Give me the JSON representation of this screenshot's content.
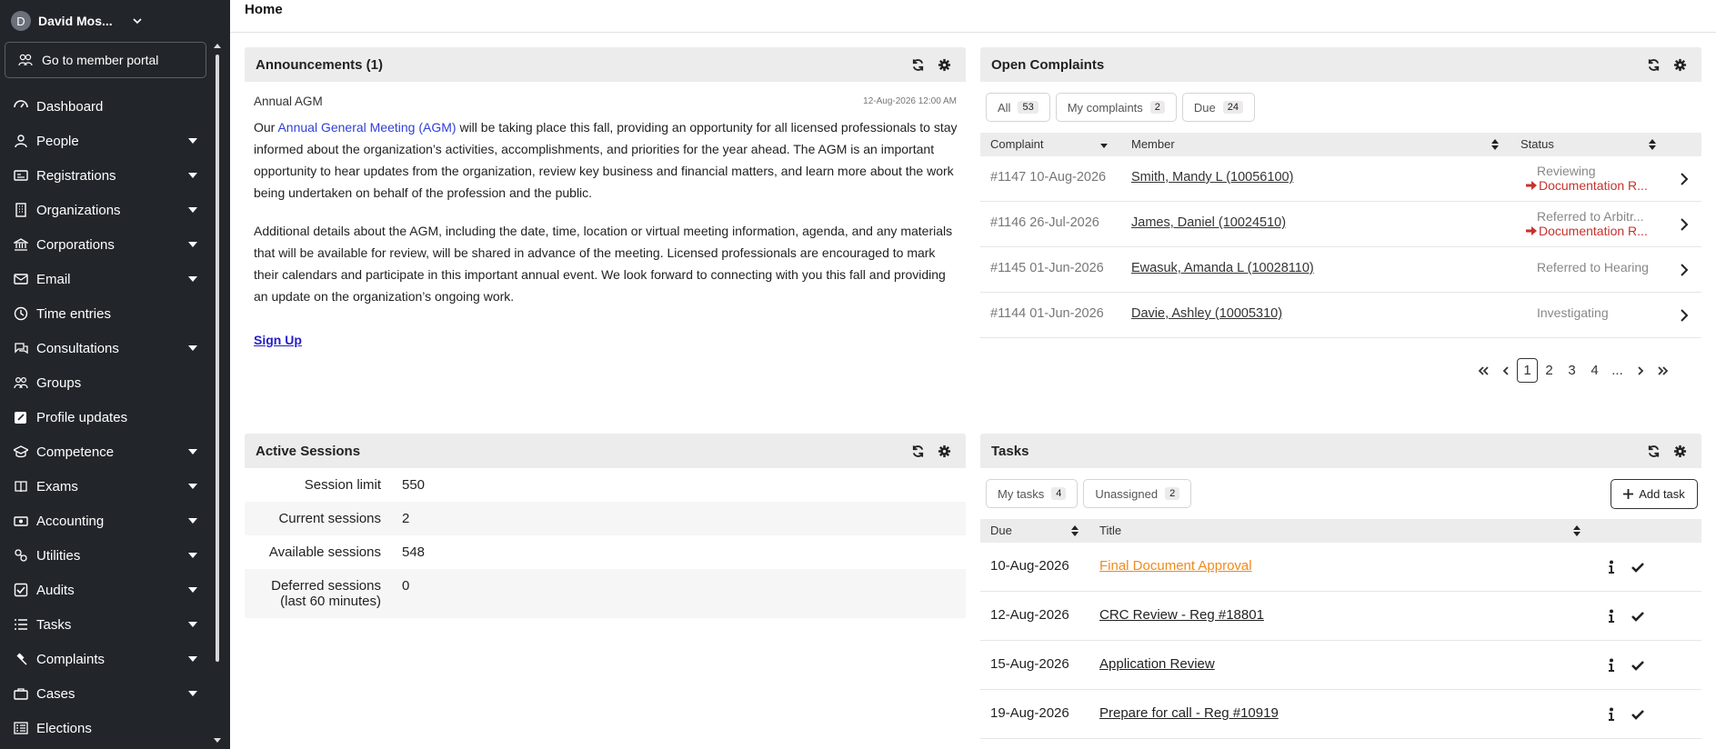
{
  "sidebar": {
    "user": {
      "initial": "D",
      "name": "David Mos..."
    },
    "portal_label": "Go to member portal",
    "items": [
      {
        "label": "Dashboard",
        "icon": "dashboard-icon",
        "expandable": false
      },
      {
        "label": "People",
        "icon": "person-icon",
        "expandable": true
      },
      {
        "label": "Registrations",
        "icon": "id-card-icon",
        "expandable": true
      },
      {
        "label": "Organizations",
        "icon": "building-icon",
        "expandable": true
      },
      {
        "label": "Corporations",
        "icon": "bank-icon",
        "expandable": true
      },
      {
        "label": "Email",
        "icon": "envelope-icon",
        "expandable": true
      },
      {
        "label": "Time entries",
        "icon": "clock-icon",
        "expandable": false
      },
      {
        "label": "Consultations",
        "icon": "chat-icon",
        "expandable": true
      },
      {
        "label": "Groups",
        "icon": "group-icon",
        "expandable": false
      },
      {
        "label": "Profile updates",
        "icon": "edit-icon",
        "expandable": false
      },
      {
        "label": "Competence",
        "icon": "graduation-cap-icon",
        "expandable": true
      },
      {
        "label": "Exams",
        "icon": "book-icon",
        "expandable": true
      },
      {
        "label": "Accounting",
        "icon": "money-icon",
        "expandable": true
      },
      {
        "label": "Utilities",
        "icon": "tools-icon",
        "expandable": true
      },
      {
        "label": "Audits",
        "icon": "check-square-icon",
        "expandable": true
      },
      {
        "label": "Tasks",
        "icon": "list-icon",
        "expandable": true
      },
      {
        "label": "Complaints",
        "icon": "gavel-icon",
        "expandable": true
      },
      {
        "label": "Cases",
        "icon": "briefcase-icon",
        "expandable": true
      },
      {
        "label": "Elections",
        "icon": "ballot-icon",
        "expandable": false
      }
    ]
  },
  "page_title": "Home",
  "announcements": {
    "title": "Announcements (1)",
    "item_title": "Annual AGM",
    "date": "12-Aug-2026 12:00 AM",
    "p1_prefix": "Our ",
    "p1_link": "Annual General Meeting (AGM)",
    "p1_rest": " will be taking place this fall, providing an opportunity for all licensed professionals to stay informed about the organization’s activities, accomplishments, and priorities for the year ahead. The AGM is an important opportunity to hear updates from the organization, review key business and financial matters, and learn more about the work being undertaken on behalf of the profession and the public.",
    "p2": "Additional details about the AGM, including the date, time, location or virtual meeting information, agenda, and any materials that will be available for review, will be shared in advance of the meeting. Licensed professionals are encouraged to mark their calendars and participate in this important annual event. We look forward to connecting with you this fall and providing an update on the organization’s ongoing work.",
    "signup": "Sign Up"
  },
  "complaints": {
    "title": "Open Complaints",
    "filters": [
      {
        "label": "All",
        "count": "53"
      },
      {
        "label": "My complaints",
        "count": "2"
      },
      {
        "label": "Due",
        "count": "24"
      }
    ],
    "columns": {
      "complaint": "Complaint",
      "member": "Member",
      "status": "Status"
    },
    "rows": [
      {
        "id": "#1147 10-Aug-2026",
        "member": "Smith, Mandy L (10056100)",
        "status": "Reviewing",
        "status2": "Documentation R..."
      },
      {
        "id": "#1146 26-Jul-2026",
        "member": "James, Daniel (10024510)",
        "status": "Referred to Arbitr...",
        "status2": "Documentation R..."
      },
      {
        "id": "#1145 01-Jun-2026",
        "member": "Ewasuk, Amanda L (10028110)",
        "status": "Referred to Hearing",
        "status2": ""
      },
      {
        "id": "#1144 01-Jun-2026",
        "member": "Davie, Ashley (10005310)",
        "status": "Investigating",
        "status2": ""
      }
    ],
    "pager": {
      "pages": [
        "1",
        "2",
        "3",
        "4",
        "..."
      ],
      "current": "1"
    }
  },
  "sessions": {
    "title": "Active Sessions",
    "rows": [
      {
        "label": "Session limit",
        "value": "550"
      },
      {
        "label": "Current sessions",
        "value": "2"
      },
      {
        "label": "Available sessions",
        "value": "548"
      },
      {
        "label": "Deferred sessions",
        "label2": "(last 60 minutes)",
        "value": "0"
      }
    ]
  },
  "tasks": {
    "title": "Tasks",
    "filters": [
      {
        "label": "My tasks",
        "count": "4"
      },
      {
        "label": "Unassigned",
        "count": "2"
      }
    ],
    "add_label": "Add task",
    "columns": {
      "due": "Due",
      "title": "Title"
    },
    "rows": [
      {
        "due": "10-Aug-2026",
        "title": "Final Document Approval",
        "highlight": true
      },
      {
        "due": "12-Aug-2026",
        "title": "CRC Review - Reg #18801",
        "highlight": false
      },
      {
        "due": "15-Aug-2026",
        "title": "Application Review",
        "highlight": false
      },
      {
        "due": "19-Aug-2026",
        "title": "Prepare for call - Reg #10919",
        "highlight": false
      }
    ]
  },
  "colors": {
    "sidebar_bg": "#22262b",
    "status_alert": "#c8322d",
    "task_highlight": "#f08a1c",
    "link": "#2f3fd6"
  }
}
